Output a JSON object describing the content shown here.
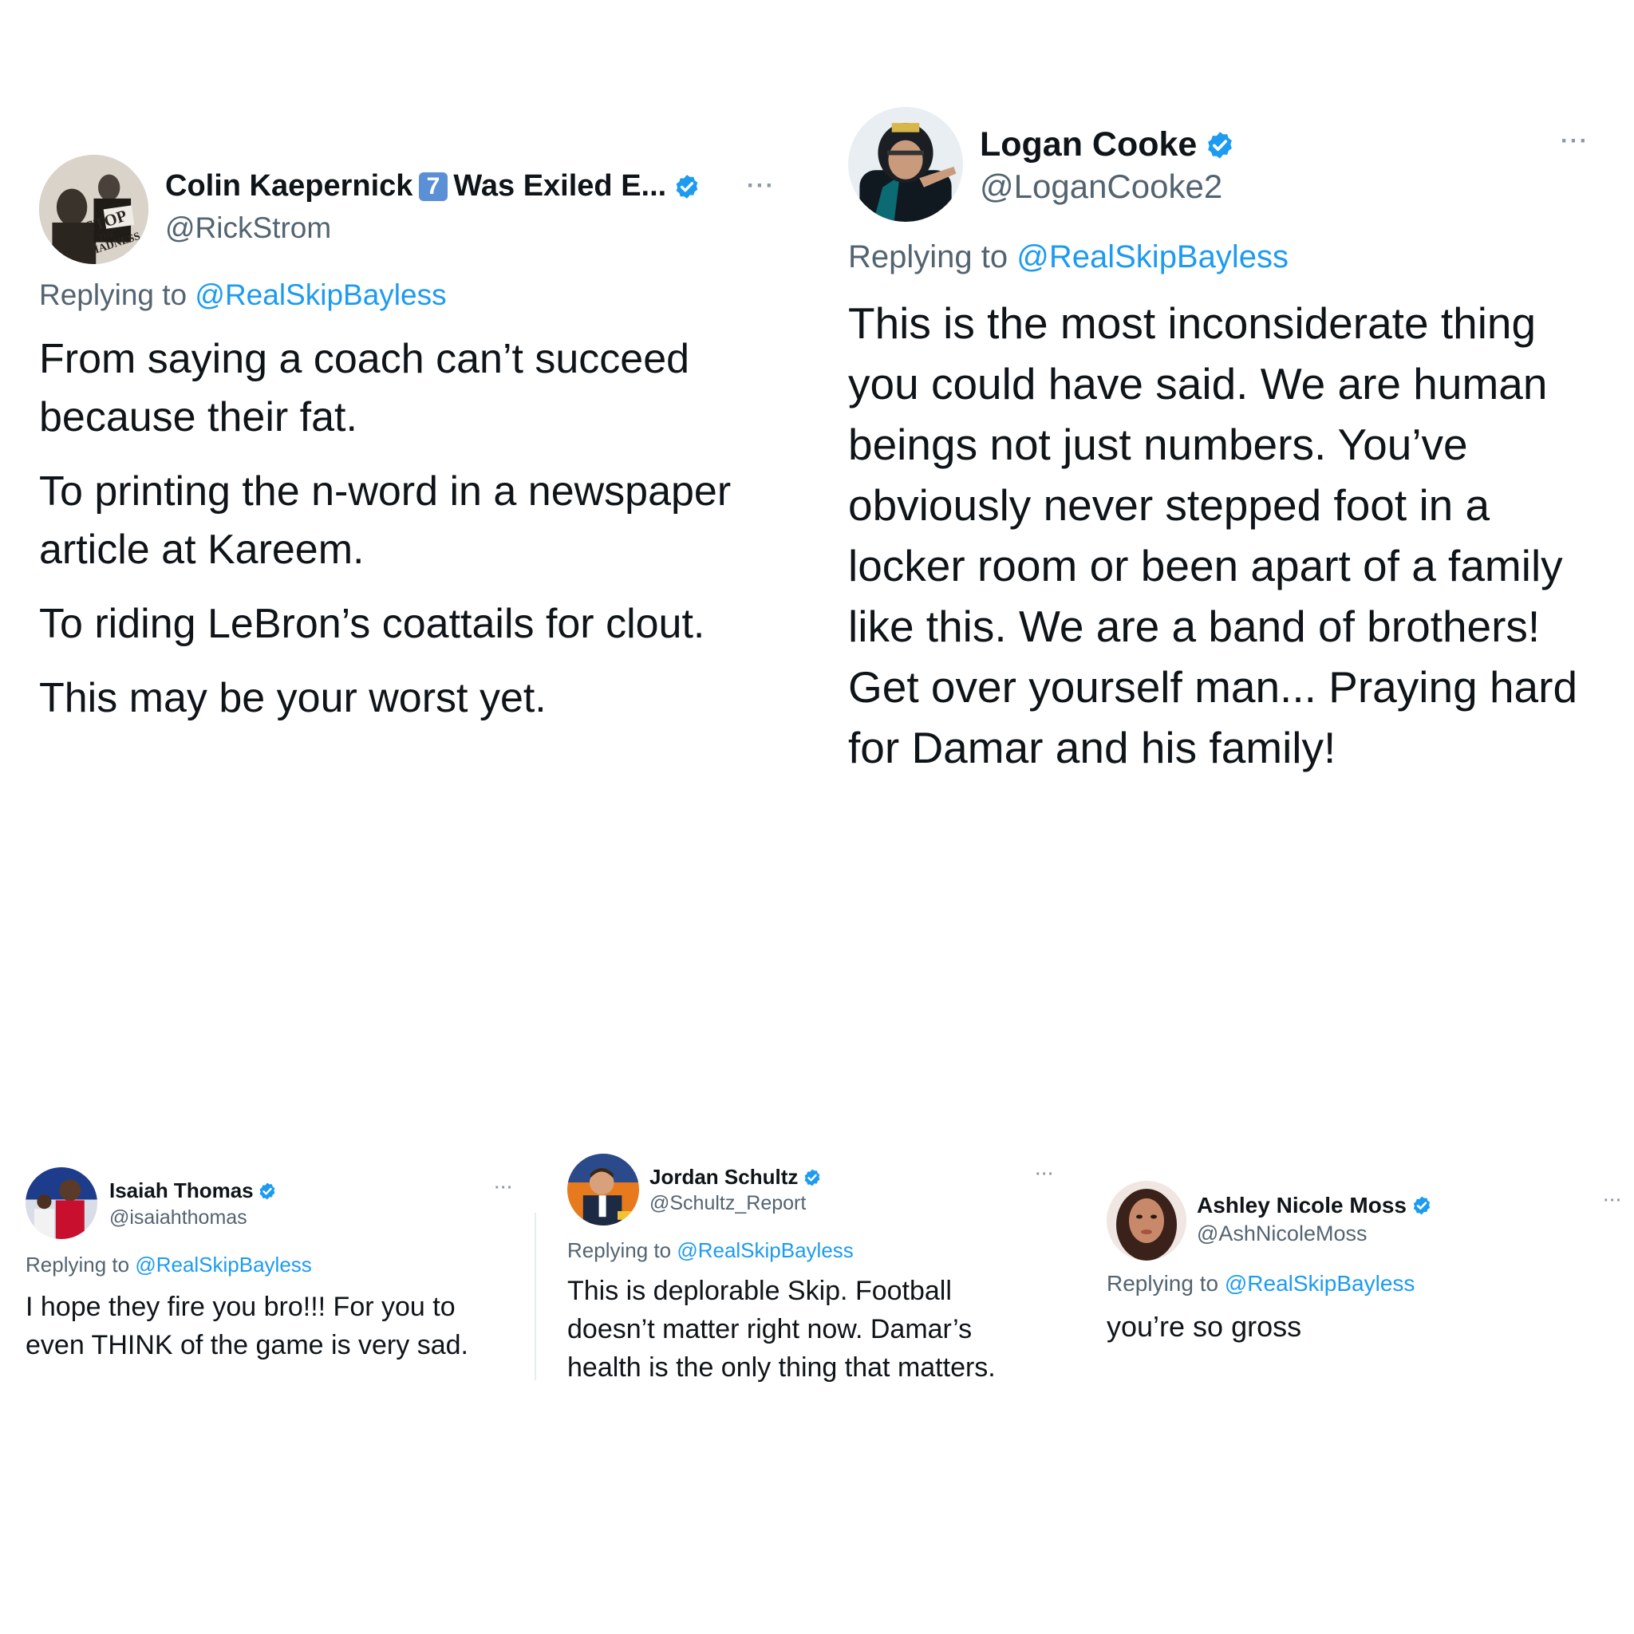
{
  "colors": {
    "link": "#1d9bf0",
    "secondary_text": "#536471",
    "primary_text": "#0f1419",
    "verified_badge": "#1d9bf0",
    "emoji_keycap": "#5b8fd6"
  },
  "tweets": [
    {
      "name_part1": "Colin Kaepernick",
      "name_emoji": "7",
      "name_part2": "Was Exiled E...",
      "handle": "@RickStrom",
      "verified": true,
      "reply_prefix": "Replying to",
      "reply_mention": "@RealSkipBayless",
      "avatar_text": {
        "line1": "STOP",
        "line2": "THE",
        "line3": "MADNESS"
      },
      "paragraphs": [
        "From saying a coach can’t succeed because their fat.",
        "To printing the n-word in a newspaper article at Kareem.",
        "To riding LeBron’s coattails for clout.",
        "This may be your worst yet."
      ],
      "more_icon": "more-dots-icon"
    },
    {
      "name": "Logan Cooke",
      "handle": "@LoganCooke2",
      "verified": true,
      "reply_prefix": "Replying to",
      "reply_mention": "@RealSkipBayless",
      "body": "This is the most inconsiderate thing you could have said. We are human beings not just numbers. You’ve obviously never stepped foot in a locker room or been apart of a family like this. We are a band of brothers! Get over yourself man... Praying hard for Damar and his family!",
      "more_icon": "more-dots-icon"
    },
    {
      "name": "Isaiah Thomas",
      "handle": "@isaiahthomas",
      "verified": true,
      "reply_prefix": "Replying to",
      "reply_mention": "@RealSkipBayless",
      "body": "I hope they fire you bro!!! For you to even THINK of the game is very sad.",
      "more_icon": "more-dots-icon"
    },
    {
      "name": "Jordan Schultz",
      "handle": "@Schultz_Report",
      "verified": true,
      "reply_prefix": "Replying to",
      "reply_mention": "@RealSkipBayless",
      "body": "This is deplorable Skip. Football doesn’t matter right now. Damar’s health is the only thing that matters.",
      "more_icon": "more-dots-icon"
    },
    {
      "name": "Ashley Nicole Moss",
      "handle": "@AshNicoleMoss",
      "verified": true,
      "reply_prefix": "Replying to",
      "reply_mention": "@RealSkipBayless",
      "body": "you’re so gross",
      "more_icon": "more-dots-icon"
    }
  ],
  "more_symbol": "···"
}
